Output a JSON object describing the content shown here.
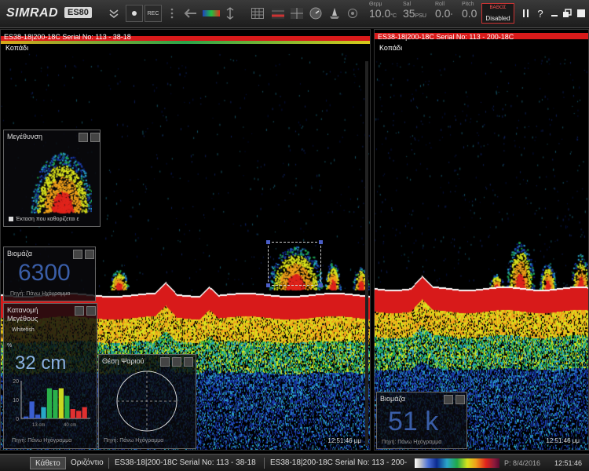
{
  "toolbar": {
    "brand": "SIMRAD",
    "model": "ES80",
    "rec_label": "REC",
    "gauges": [
      {
        "label": "Θερμ",
        "value": "10.0",
        "unit": "°C"
      },
      {
        "label": "Sal",
        "value": "35",
        "unit": "PSU"
      },
      {
        "label": "Roll",
        "value": "0.0",
        "unit": "°"
      },
      {
        "label": "Pitch",
        "value": "0.0",
        "unit": ""
      }
    ],
    "depth_title": "ΒΑΘΟΣ",
    "depth_state": "Disabled",
    "help": "?"
  },
  "left_pane": {
    "title": "ES38-18|200-18C Serial No: 113 - 38-18",
    "sub": "Κοπάδι",
    "time": "12:51:46 μμ"
  },
  "right_pane": {
    "title": "ES38-18|200-18C Serial No: 113 - 200-18C",
    "sub": "Κοπάδι",
    "time": "12:51:46 μμ"
  },
  "zoom_widget": {
    "title": "Μεγέθυνση",
    "checkbox_label": "Έκταση που καθορίζεται ε"
  },
  "biomass_left": {
    "title": "Βιομάζα",
    "value": "6300",
    "source": "Πηγή: Πάνω Ηχόγραμμα"
  },
  "size_widget": {
    "title_line1": "Κατανομή",
    "title_line2": "Μεγέθους",
    "species": "Whitefish",
    "percent_label": "%",
    "value": "32 cm",
    "y_ticks": [
      "20",
      "10",
      "0"
    ],
    "x_ticks": [
      "13 cm",
      "40 cm"
    ],
    "source": "Πηγή: Πάνω Ηχόγραμμα",
    "histogram": [
      {
        "value": 1,
        "color": "#3a5ed0"
      },
      {
        "value": 9,
        "color": "#3a5ed0"
      },
      {
        "value": 2,
        "color": "#3a5ed0"
      },
      {
        "value": 6,
        "color": "#28a8c8"
      },
      {
        "value": 16,
        "color": "#2ab04a"
      },
      {
        "value": 15,
        "color": "#2ab04a"
      },
      {
        "value": 16,
        "color": "#c8d820"
      },
      {
        "value": 12,
        "color": "#2ab04a"
      },
      {
        "value": 5,
        "color": "#e03030"
      },
      {
        "value": 4,
        "color": "#e03030"
      },
      {
        "value": 6,
        "color": "#e03030"
      }
    ]
  },
  "position_widget": {
    "title": "Θέση Ψαριού",
    "source": "Πηγή: Πάνω Ηχόγραμμα"
  },
  "biomass_right": {
    "title": "Βιομάζα",
    "value": "51 k",
    "source": "Πηγή: Πάνω Ηχόγραμμα"
  },
  "statusbar": {
    "tab_vertical": "Κάθετο",
    "tab_horizontal": "Οριζόντιο",
    "channel1": "ES38-18|200-18C Serial No: 113 - 38-18",
    "channel2": "ES38-18|200-18C Serial No: 113 - 200-",
    "playback": "P: 8/4/2016",
    "clock": "12:51:46"
  },
  "colors": {
    "bottom_red": "#d81a1a",
    "accent_blue": "#3a5ea8"
  }
}
